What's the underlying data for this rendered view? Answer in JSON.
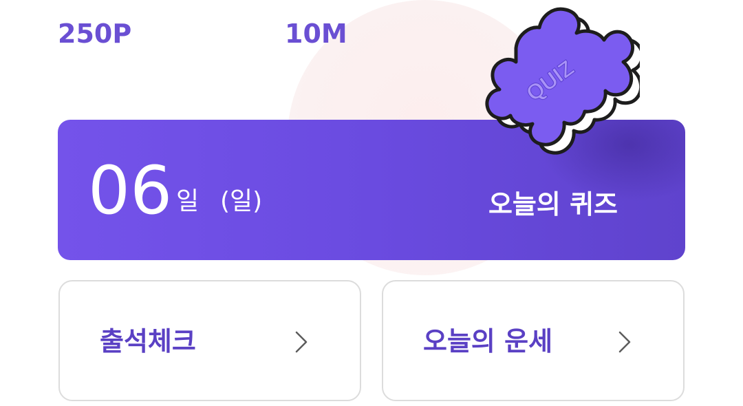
{
  "stats": {
    "points": "250P",
    "minutes": "10M"
  },
  "quiz_banner": {
    "day": "06",
    "day_unit": "일",
    "weekday": "(일)",
    "title": "오늘의 퀴즈",
    "icon_text": "QUIZ",
    "icon": "puzzle-piece-icon"
  },
  "cards": {
    "attendance": {
      "label": "출석체크",
      "icon": "chevron-right-icon"
    },
    "fortune": {
      "label": "오늘의 운세",
      "icon": "chevron-right-icon"
    }
  },
  "colors": {
    "accent": "#6a4fd3",
    "banner_start": "#7453ea",
    "banner_end": "#5f43cd",
    "card_border": "#dcdcdc",
    "background_circle": "#fdeeee"
  }
}
